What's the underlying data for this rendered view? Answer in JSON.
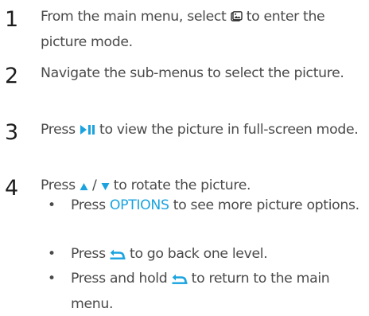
{
  "steps": [
    {
      "number": "1",
      "text_before": "From the main menu, select ",
      "icon": "picture-mode-icon",
      "text_after": " to enter the picture mode."
    },
    {
      "number": "2",
      "text": "Navigate the sub-menus to select the picture."
    },
    {
      "number": "3",
      "text_before": "Press ",
      "icon": "play-pause-icon",
      "text_after": " to view the picture in full-screen mode."
    },
    {
      "number": "4",
      "text_before": "Press ",
      "icon_up": "triangle-up-icon",
      "separator": " / ",
      "icon_down": "triangle-down-icon",
      "text_after": " to rotate the picture."
    }
  ],
  "bullets": [
    {
      "dot": "•",
      "text_before": "Press ",
      "keyword": "OPTIONS",
      "text_after": " to see more picture options."
    },
    {
      "dot": "•",
      "text_before": "Press ",
      "icon": "back-arrow-icon",
      "text_after": " to go back one level."
    },
    {
      "dot": "•",
      "text_before": "Press and hold ",
      "icon": "back-arrow-icon",
      "text_after": " to return to the main menu."
    }
  ],
  "colors": {
    "text": "#4a4a4a",
    "number": "#1d1d1d",
    "accent": "#1aa3df"
  }
}
